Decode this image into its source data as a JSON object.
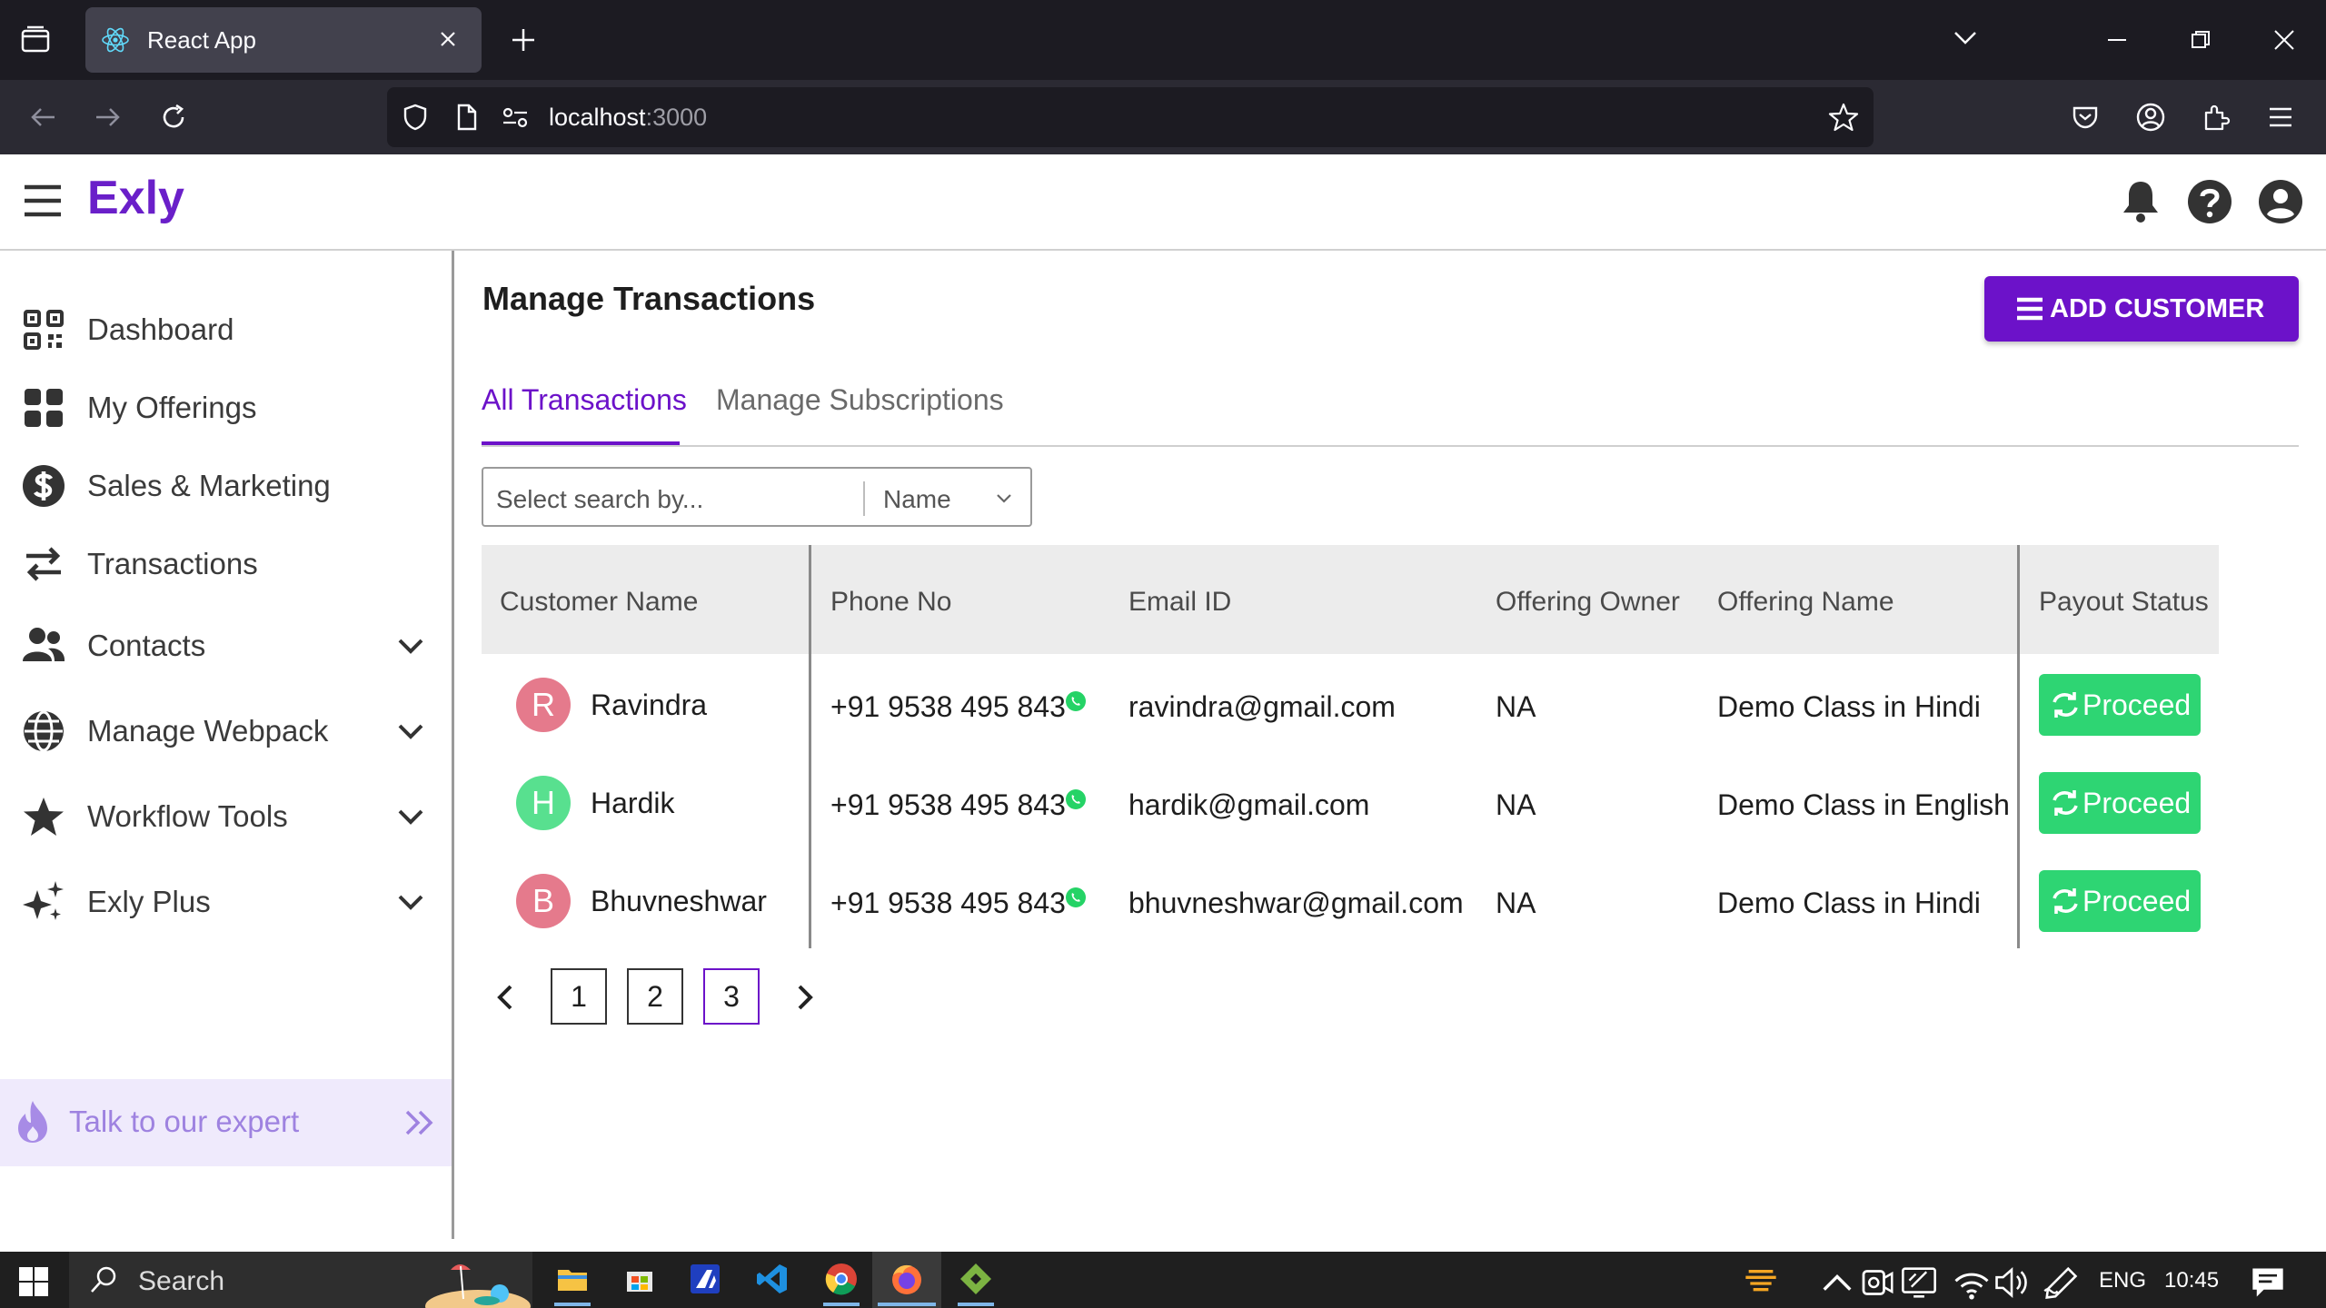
{
  "browser": {
    "tab_title": "React App",
    "url_host": "localhost",
    "url_port": ":3000"
  },
  "app": {
    "logo": "Exly"
  },
  "sidebar": {
    "items": [
      {
        "label": "Dashboard",
        "icon": "qr-grid-icon"
      },
      {
        "label": "My Offerings",
        "icon": "tiles-icon"
      },
      {
        "label": "Sales & Marketing",
        "icon": "dollar-circle-icon"
      },
      {
        "label": "Transactions",
        "icon": "swap-arrows-icon"
      },
      {
        "label": "Contacts",
        "icon": "people-icon"
      },
      {
        "label": "Manage Webpack",
        "icon": "globe-icon"
      },
      {
        "label": "Workflow Tools",
        "icon": "star-icon"
      },
      {
        "label": "Exly Plus",
        "icon": "sparkles-icon"
      }
    ],
    "expert_label": "Talk to our expert"
  },
  "main": {
    "title": "Manage Transactions",
    "add_button": "ADD CUSTOMER",
    "tabs": [
      {
        "label": "All Transactions",
        "active": true
      },
      {
        "label": "Manage Subscriptions",
        "active": false
      }
    ],
    "search": {
      "placeholder": "Select search by...",
      "field": "Name"
    },
    "table": {
      "headers": [
        "Customer Name",
        "Phone No",
        "Email ID",
        "Offering Owner",
        "Offering Name",
        "Payout Status"
      ],
      "rows": [
        {
          "initial": "R",
          "avatar_color": "#e57a8c",
          "name": "Ravindra",
          "phone": "+91 9538 495 843",
          "email": "ravindra@gmail.com",
          "owner": "NA",
          "offering": "Demo Class in Hindi",
          "status": "Proceed"
        },
        {
          "initial": "H",
          "avatar_color": "#58e08f",
          "name": "Hardik",
          "phone": "+91 9538 495 843",
          "email": "hardik@gmail.com",
          "owner": "NA",
          "offering": "Demo Class in English",
          "status": "Proceed"
        },
        {
          "initial": "B",
          "avatar_color": "#e57a8c",
          "name": "Bhuvneshwar",
          "phone": "+91 9538 495 843",
          "email": "bhuvneshwar@gmail.com",
          "owner": "NA",
          "offering": "Demo Class in Hindi",
          "status": "Proceed"
        }
      ]
    },
    "pagination": {
      "pages": [
        "1",
        "2",
        "3"
      ],
      "current": "3"
    }
  },
  "taskbar": {
    "search_label": "Search",
    "language": "ENG",
    "time": "10:45"
  },
  "colors": {
    "brand": "#6c12c9",
    "success": "#2ed573"
  }
}
